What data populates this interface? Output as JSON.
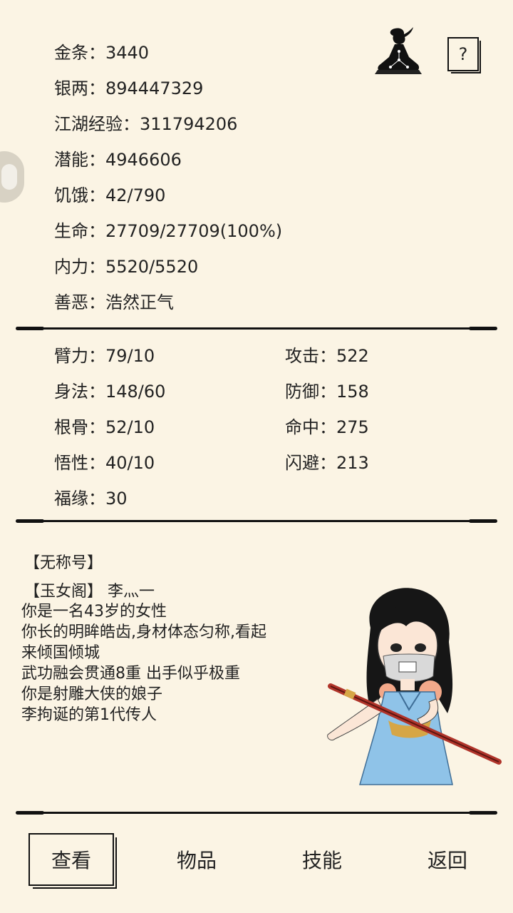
{
  "stats": [
    {
      "label": "金条",
      "value": "3440"
    },
    {
      "label": "银两",
      "value": "894447329"
    },
    {
      "label": "江湖经验",
      "value": "311794206"
    },
    {
      "label": "潜能",
      "value": "4946606"
    },
    {
      "label": "饥饿",
      "value": "42/790"
    },
    {
      "label": "生命",
      "value": "27709/27709(100%)"
    },
    {
      "label": "内力",
      "value": "5520/5520"
    },
    {
      "label": "善恶",
      "value": "浩然正气"
    }
  ],
  "attributes_left": [
    {
      "label": "臂力",
      "value": "79/10"
    },
    {
      "label": "身法",
      "value": "148/60"
    },
    {
      "label": "根骨",
      "value": "52/10"
    },
    {
      "label": "悟性",
      "value": "40/10"
    },
    {
      "label": "福缘",
      "value": "30"
    }
  ],
  "attributes_right": [
    {
      "label": "攻击",
      "value": "522"
    },
    {
      "label": "防御",
      "value": "158"
    },
    {
      "label": "命中",
      "value": "275"
    },
    {
      "label": "闪避",
      "value": "213"
    }
  ],
  "separator": "：",
  "title_line": "【无称号】",
  "sect_line": "【玉女阁】 李灬一",
  "bio": [
    "你是一名43岁的女性",
    "你长的明眸皓齿,身材体态匀称,看起",
    "来倾国倾城",
    "武功融会贯通8重 出手似乎极重",
    "你是射雕大侠的娘子",
    "李拘诞的第1代传人"
  ],
  "help_label": "?",
  "nav": [
    {
      "label": "查看",
      "active": true
    },
    {
      "label": "物品",
      "active": false
    },
    {
      "label": "技能",
      "active": false
    },
    {
      "label": "返回",
      "active": false
    }
  ],
  "colors": {
    "background": "#fbf4e4",
    "ink": "#111111",
    "dress": "#8fc3e8",
    "sword": "#b0342a"
  }
}
